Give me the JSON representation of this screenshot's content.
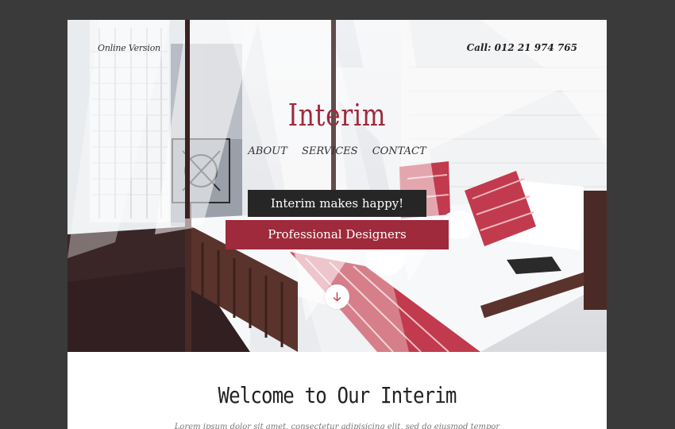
{
  "header": {
    "online_version": "Online Version",
    "call": "Call: 012 21 974 765"
  },
  "brand": {
    "logo": "Interim",
    "color": "#9e2a3c"
  },
  "nav": {
    "items": [
      "ABOUT",
      "SERVICES",
      "CONTACT"
    ]
  },
  "hero": {
    "tagline": "Interim makes happy!",
    "subline": "Professional Designers",
    "scroll_icon": "arrow-down-icon"
  },
  "welcome": {
    "title": "Welcome to Our Interim",
    "intro": "Lorem ipsum dolor sit amet, consectetur adipisicing elit, sed do eiusmod tempor"
  }
}
